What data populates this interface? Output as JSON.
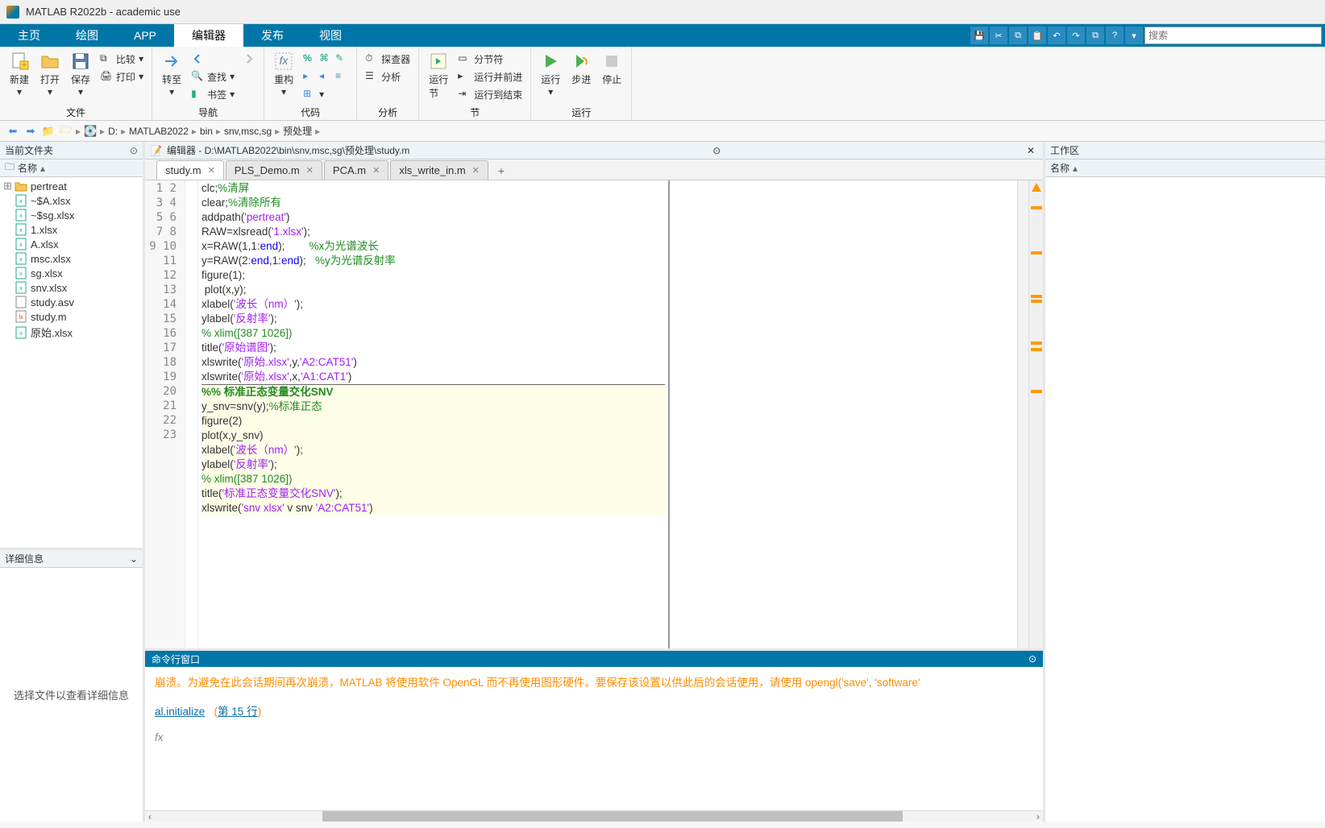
{
  "window": {
    "title": "MATLAB R2022b - academic use"
  },
  "ribbon": {
    "tabs": [
      "主页",
      "绘图",
      "APP",
      "编辑器",
      "发布",
      "视图"
    ],
    "active": 3,
    "search_placeholder": "搜索"
  },
  "toolbar": {
    "groups": {
      "file": {
        "label": "文件",
        "buttons": {
          "new": "新建",
          "open": "打开",
          "save": "保存",
          "compare": "比较",
          "print": "打印"
        }
      },
      "nav": {
        "label": "导航",
        "buttons": {
          "goto": "转至",
          "find": "查找",
          "bookmarks": "书签"
        }
      },
      "code": {
        "label": "代码",
        "buttons": {
          "refactor": "重构"
        }
      },
      "analyze": {
        "label": "分析",
        "buttons": {
          "profiler": "探查器",
          "analyze": "分析"
        }
      },
      "section": {
        "label": "节",
        "buttons": {
          "run_section": "运行\n节",
          "section_break": "分节符",
          "run_advance": "运行并前进",
          "run_to_end": "运行到结束"
        }
      },
      "run": {
        "label": "运行",
        "buttons": {
          "run": "运行",
          "step": "步进",
          "stop": "停止"
        }
      }
    }
  },
  "path": {
    "drive": "D:",
    "parts": [
      "MATLAB2022",
      "bin",
      "snv,msc,sg",
      "预处理"
    ]
  },
  "left_panel": {
    "title": "当前文件夹",
    "col": "名称",
    "files": [
      {
        "name": "pertreat",
        "type": "folder"
      },
      {
        "name": "~$A.xlsx",
        "type": "xlsx"
      },
      {
        "name": "~$sg.xlsx",
        "type": "xlsx"
      },
      {
        "name": "1.xlsx",
        "type": "xlsx"
      },
      {
        "name": "A.xlsx",
        "type": "xlsx"
      },
      {
        "name": "msc.xlsx",
        "type": "xlsx"
      },
      {
        "name": "sg.xlsx",
        "type": "xlsx"
      },
      {
        "name": "snv.xlsx",
        "type": "xlsx"
      },
      {
        "name": "study.asv",
        "type": "asv"
      },
      {
        "name": "study.m",
        "type": "m"
      },
      {
        "name": "原始.xlsx",
        "type": "xlsx"
      }
    ],
    "details_title": "详细信息",
    "details_body": "选择文件以查看详细信息"
  },
  "editor": {
    "header": "编辑器 - D:\\MATLAB2022\\bin\\snv,msc,sg\\预处理\\study.m",
    "tabs": [
      {
        "name": "study.m",
        "active": true
      },
      {
        "name": "PLS_Demo.m",
        "active": false
      },
      {
        "name": "PCA.m",
        "active": false
      },
      {
        "name": "xls_write_in.m",
        "active": false
      }
    ],
    "line_start": 1,
    "line_end": 23
  },
  "cmd": {
    "title": "命令行窗口",
    "warn_text": "崩溃。为避免在此会话期间再次崩溃，MATLAB 将使用软件 OpenGL 而不再使用图形硬件。要保存该设置以供此后的会话使用，请使用 opengl('save', 'software'",
    "link1": "al.initialize",
    "link2_open": "(",
    "link2": "第 15 行",
    "link2_close": ")",
    "prompt": "fx"
  },
  "right_panel": {
    "title": "工作区",
    "col": "名称"
  }
}
